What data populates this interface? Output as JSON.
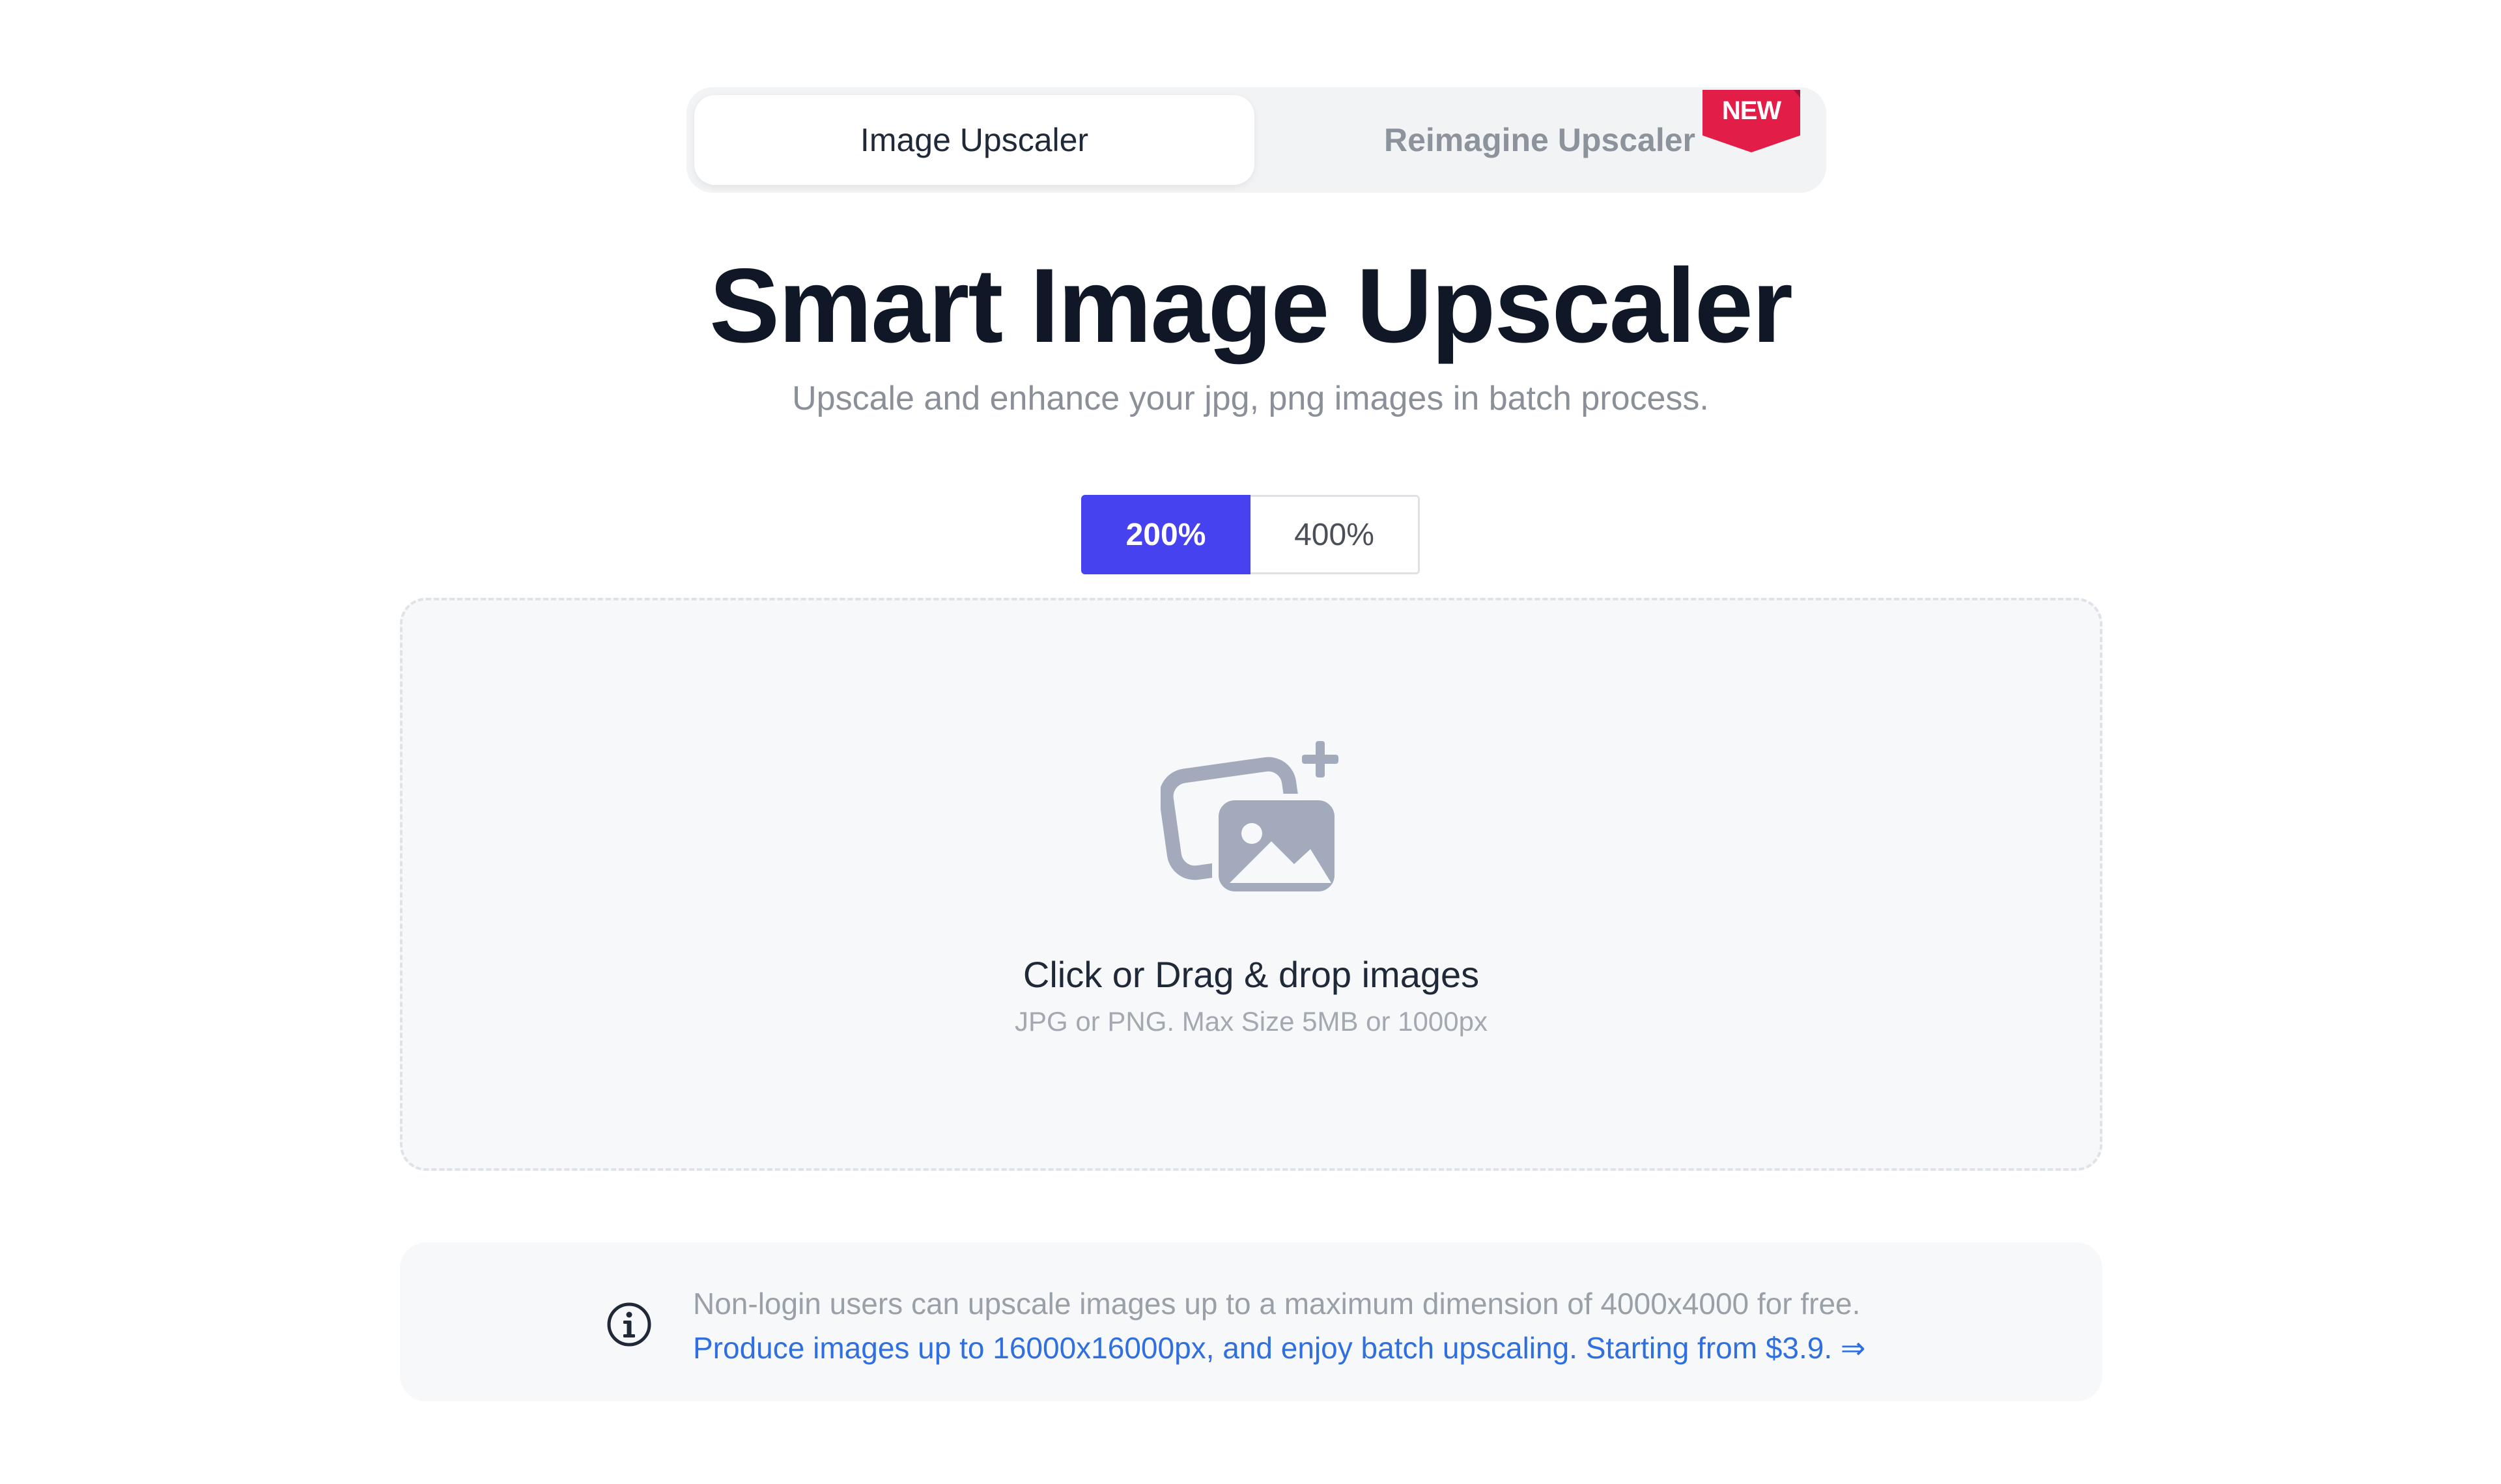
{
  "mode_tabs": {
    "active_label": "Image Upscaler",
    "inactive_label": "Reimagine Upscaler",
    "new_badge": "NEW",
    "new_badge_color": "#e11d48"
  },
  "hero": {
    "title": "Smart Image Upscaler",
    "subtitle": "Upscale and enhance your jpg, png images in batch process."
  },
  "scale_options": {
    "selected_label": "200%",
    "other_label": "400%",
    "accent_color": "#4742ef"
  },
  "drop_zone": {
    "icon": "image-add-icon",
    "title": "Click or Drag & drop images",
    "hint": "JPG or PNG. Max Size 5MB or 1000px"
  },
  "info_banner": {
    "icon": "info-icon",
    "line1": "Non-login users can upscale images up to a maximum dimension of 4000x4000 for free.",
    "line2": "Produce images up to 16000x16000px, and enjoy batch upscaling. Starting from $3.9. ⇒",
    "link_color": "#2f6fe0"
  }
}
